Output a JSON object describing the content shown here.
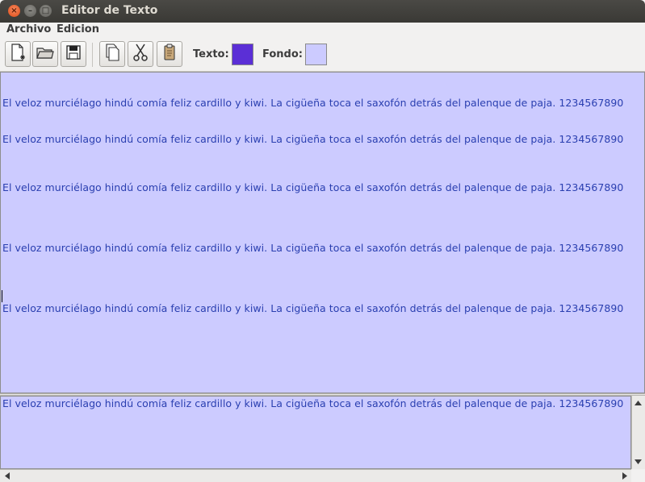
{
  "window": {
    "title": "Editor de Texto"
  },
  "menu": [
    {
      "label": "Archivo"
    },
    {
      "label": "Edicion"
    }
  ],
  "toolbar": {
    "buttons": [
      {
        "icon": "new-document-icon"
      },
      {
        "icon": "open-folder-icon"
      },
      {
        "icon": "save-disk-icon"
      },
      {
        "icon": "copy-icon"
      },
      {
        "icon": "cut-scissors-icon"
      },
      {
        "icon": "paste-clipboard-icon"
      }
    ],
    "text_label": "Texto:",
    "text_color": "#5b2fd6",
    "background_label": "Fondo:",
    "background_color": "#cccbff"
  },
  "editor": {
    "background_color": "#cccbff",
    "text_color": "#2a3fb0",
    "lines": [
      "El veloz murciélago hindú comía feliz cardillo y kiwi. La cigüeña toca el saxofón detrás del palenque de paja. 1234567890",
      "El veloz murciélago hindú comía feliz cardillo y kiwi. La cigüeña toca el saxofón detrás del palenque de paja. 1234567890",
      "El veloz murciélago hindú comía feliz cardillo y kiwi. La cigüeña toca el saxofón detrás del palenque de paja. 1234567890",
      "El veloz murciélago hindú comía feliz cardillo y kiwi. La cigüeña toca el saxofón detrás del palenque de paja. 1234567890",
      "El veloz murciélago hindú comía feliz cardillo y kiwi. La cigüeña toca el saxofón detrás del palenque de paja. 1234567890"
    ]
  },
  "preview": {
    "line": "El veloz murciélago hindú comía feliz cardillo y kiwi. La cigüeña toca el saxofón detrás del palenque de paja. 1234567890"
  }
}
